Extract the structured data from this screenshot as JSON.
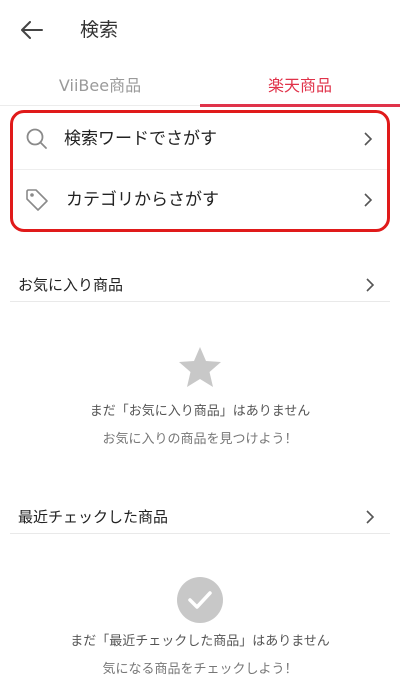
{
  "header": {
    "title": "検索"
  },
  "tabs": [
    {
      "label": "ViiBee商品",
      "active": false
    },
    {
      "label": "楽天商品",
      "active": true
    }
  ],
  "search_options": [
    {
      "label": "検索ワードでさがす",
      "icon": "search-icon"
    },
    {
      "label": "カテゴリからさがす",
      "icon": "tag-icon"
    }
  ],
  "favorites": {
    "title": "お気に入り商品",
    "empty_title": "まだ「お気に入り商品」はありません",
    "empty_hint": "お気に入りの商品を見つけよう！"
  },
  "recent": {
    "title": "最近チェックした商品",
    "empty_title": "まだ「最近チェックした商品」はありません",
    "empty_hint": "気になる商品をチェックしよう！"
  },
  "colors": {
    "accent": "#e0334a",
    "highlight": "#e01a1a",
    "icon_gray": "#c8c8c8"
  }
}
